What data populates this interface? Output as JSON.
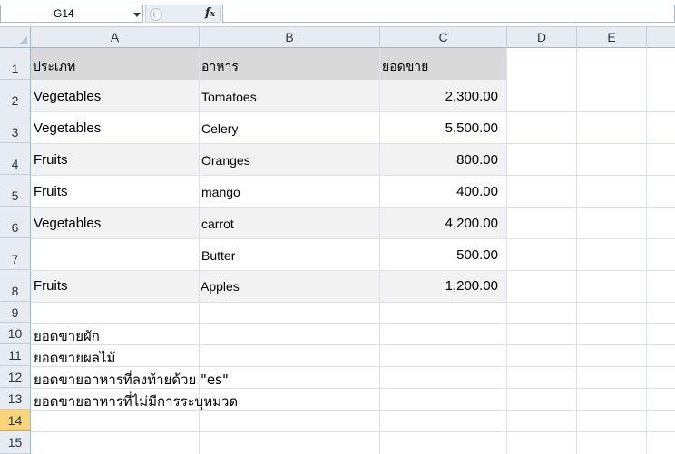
{
  "formula_bar": {
    "name_box": "G14",
    "fx_label": "f",
    "fx_sub": "x",
    "formula": ""
  },
  "columns": [
    "A",
    "B",
    "C",
    "D",
    "E"
  ],
  "rows": [
    {
      "num": "1",
      "a": "ประเภท",
      "b": "อาหาร",
      "c": "ยอดขาย"
    },
    {
      "num": "2",
      "a": "Vegetables",
      "b": "Tomatoes",
      "c": "2,300.00"
    },
    {
      "num": "3",
      "a": "Vegetables",
      "b": "Celery",
      "c": "5,500.00"
    },
    {
      "num": "4",
      "a": "Fruits",
      "b": "Oranges",
      "c": "800.00"
    },
    {
      "num": "5",
      "a": "Fruits",
      "b": "mango",
      "c": "400.00"
    },
    {
      "num": "6",
      "a": "Vegetables",
      "b": "carrot",
      "c": "4,200.00"
    },
    {
      "num": "7",
      "a": "",
      "b": "Butter",
      "c": "500.00"
    },
    {
      "num": "8",
      "a": "Fruits",
      "b": "Apples",
      "c": "1,200.00"
    },
    {
      "num": "9",
      "a": "",
      "b": "",
      "c": ""
    },
    {
      "num": "10",
      "a": "ยอดขายผัก",
      "b": "",
      "c": ""
    },
    {
      "num": "11",
      "a": "ยอดขายผลไม้",
      "b": "",
      "c": ""
    },
    {
      "num": "12",
      "a": "ยอดขายอาหารที่ลงท้ายด้วย \"es\"",
      "b": "",
      "c": ""
    },
    {
      "num": "13",
      "a": "ยอดขายอาหารที่ไม่มีการระบุหมวด",
      "b": "",
      "c": ""
    },
    {
      "num": "14",
      "a": "",
      "b": "",
      "c": ""
    },
    {
      "num": "15",
      "a": "",
      "b": "",
      "c": ""
    }
  ],
  "selected_cell": "G14",
  "colors": {
    "header_band": "#d9d9d9",
    "row_band": "#f2f2f2",
    "selected_row_header": "#f8d47a"
  }
}
